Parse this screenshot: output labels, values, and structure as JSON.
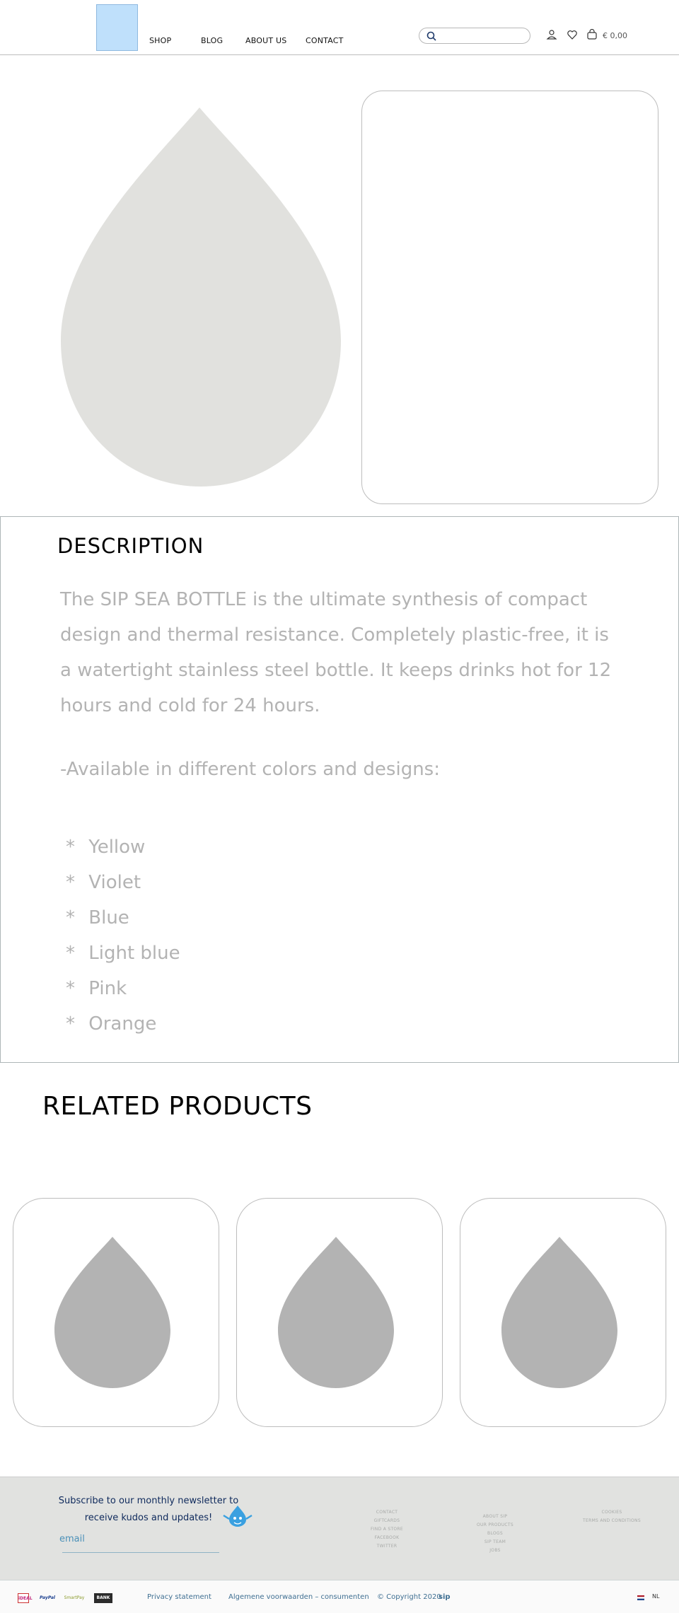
{
  "header": {
    "nav": [
      "SHOP",
      "BLOG",
      "ABOUT US",
      "CONTACT"
    ],
    "search_placeholder": "",
    "cart_total": "€ 0,00"
  },
  "description": {
    "title": "DESCRIPTION",
    "body": "The SIP SEA BOTTLE  is the ultimate synthesis of compact design and thermal resistance. Completely plastic-free, it is a watertight stainless steel bottle. It keeps drinks hot for 12 hours and cold for 24 hours.",
    "available": "-Available in different colors and designs:",
    "colors": [
      "Yellow",
      "Violet",
      "Blue",
      "Light blue",
      "Pink",
      "Orange"
    ]
  },
  "related": {
    "title": "RELATED PRODUCTS"
  },
  "footer": {
    "newsletter_line1": "Subscribe to our monthly newsletter to",
    "newsletter_line2": "receive kudos and updates!",
    "email_label": "email",
    "col1": [
      "CONTACT",
      "GIFTCARDS",
      "FIND A STORE",
      "FACEBOOK",
      "TWITTER"
    ],
    "col2": [
      "ABOUT SIP",
      "OUR PRODUCTS",
      "BLOGS",
      "SIP TEAM",
      "JOBS"
    ],
    "col3": [
      "COOKIES",
      "TERMS AND CONDITIONS"
    ]
  },
  "bottombar": {
    "payments": [
      "iDEAL",
      "PayPal",
      "SmartPay",
      "BANK"
    ],
    "privacy": "Privacy statement",
    "terms": "Algemene voorwaarden – consumenten",
    "copyright": "© Copyright 2020",
    "brand": "sip",
    "lang": "NL"
  },
  "colors": {
    "drop_light": "#e1e1de",
    "drop_dark": "#b3b3b3",
    "footer_bg": "#e1e2e0",
    "logo_blue": "#bfe0fb"
  }
}
